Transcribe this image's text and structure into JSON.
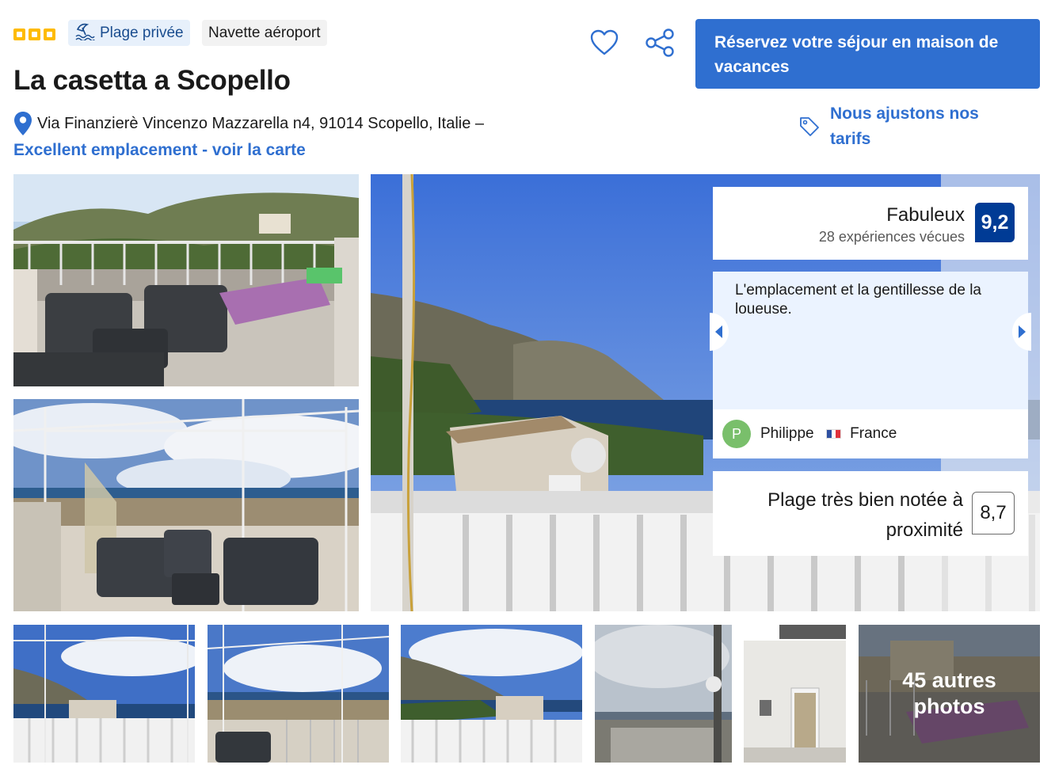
{
  "header": {
    "stars": 3,
    "chips": [
      {
        "label": "Plage privée",
        "icon": "beach-icon"
      },
      {
        "label": "Navette aéroport"
      }
    ],
    "title": "La casetta a Scopello",
    "address": "Via Finanzierè Vincenzo Mazzarella n4, 91014 Scopello, Italie –",
    "map_link": "Excellent emplacement - voir la carte",
    "cta_label": "Réservez votre séjour en maison de vacances",
    "price_note": "Nous ajustons nos tarifs"
  },
  "review_panel": {
    "score_word": "Fabuleux",
    "score_count": "28 expériences vécues",
    "score": "9,2",
    "quote": "L'emplacement et la gentillesse de la loueuse.",
    "reviewer_initial": "P",
    "reviewer_name": "Philippe",
    "reviewer_country": "France",
    "nearby_label": "Plage très bien notée à proximité",
    "nearby_score": "8,7"
  },
  "gallery": {
    "more_photos": "45 autres photos"
  },
  "colors": {
    "brand_blue": "#2f6fd0",
    "score_dark_blue": "#003b95",
    "star_yellow": "#febb02",
    "review_bg": "#ebf3ff"
  }
}
